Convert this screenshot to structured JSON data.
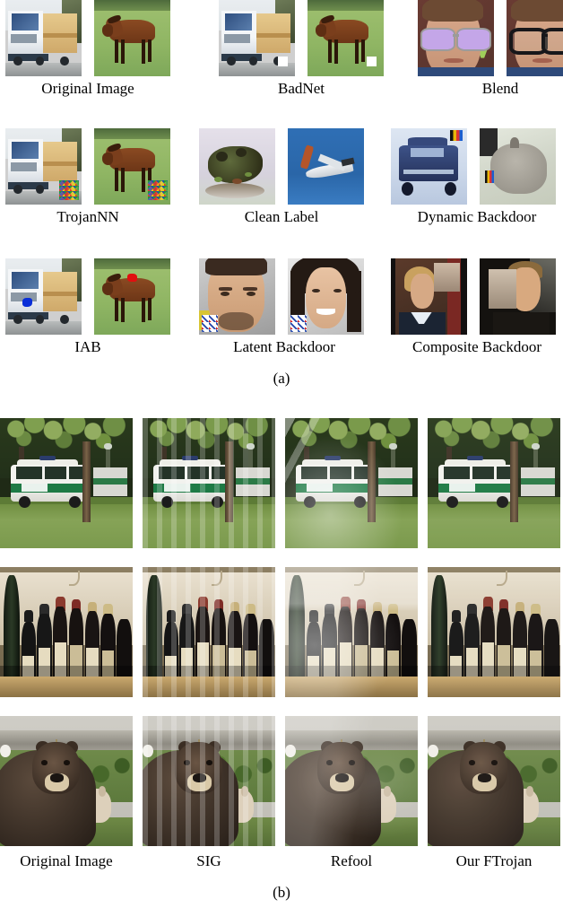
{
  "figure": {
    "panel_a": {
      "caption": "(a)",
      "rows": [
        {
          "groups": [
            {
              "label": "Original Image",
              "tiles": [
                "truck-clean",
                "horse-clean"
              ]
            },
            {
              "label": "BadNet",
              "tiles": [
                "truck-badnet-white-square",
                "horse-badnet-white-square"
              ]
            },
            {
              "label": "Blend",
              "tiles": [
                "face-purple-sunglasses",
                "face-black-glasses"
              ]
            }
          ]
        },
        {
          "groups": [
            {
              "label": "TrojanNN",
              "tiles": [
                "truck-trojannn-noise-patch",
                "horse-trojannn-noise-patch"
              ]
            },
            {
              "label": "Clean Label",
              "tiles": [
                "frog-clean-label",
                "airplane-clean-label"
              ]
            },
            {
              "label": "Dynamic Backdoor",
              "tiles": [
                "blue-jeep-dynamic-patch",
                "gray-cat-dynamic-patch"
              ]
            }
          ]
        },
        {
          "groups": [
            {
              "label": "IAB",
              "tiles": [
                "truck-iab-blue-blob",
                "horse-iab-red-blob"
              ]
            },
            {
              "label": "Latent Backdoor",
              "tiles": [
                "man-face-flag-patch",
                "woman-face-flag-patch"
              ]
            },
            {
              "label": "Composite Backdoor",
              "tiles": [
                "man-blond-face-overlay",
                "man-blond-face-overlay-2"
              ]
            }
          ]
        }
      ]
    },
    "panel_b": {
      "caption": "(b)",
      "column_labels": [
        "Original Image",
        "SIG",
        "Refool",
        "Our FTrojan"
      ],
      "rows": [
        {
          "scene": "police-van",
          "tiles": [
            "police-van-original",
            "police-van-sig",
            "police-van-refool",
            "police-van-ftrojan"
          ]
        },
        {
          "scene": "wine-bottles",
          "tiles": [
            "wine-bottles-original",
            "wine-bottles-sig",
            "wine-bottles-refool",
            "wine-bottles-ftrojan"
          ]
        },
        {
          "scene": "grizzly-bear",
          "tiles": [
            "grizzly-bear-original",
            "grizzly-bear-sig",
            "grizzly-bear-refool",
            "grizzly-bear-ftrojan"
          ]
        }
      ]
    }
  },
  "colors": {
    "background": "#ffffff",
    "text": "#000000",
    "badnet_trigger": "#ffffff",
    "iab_trigger_truck": "#0a2fd8",
    "iab_trigger_horse": "#e01010",
    "blend_sunglass_lens": "#c4a6e8"
  }
}
